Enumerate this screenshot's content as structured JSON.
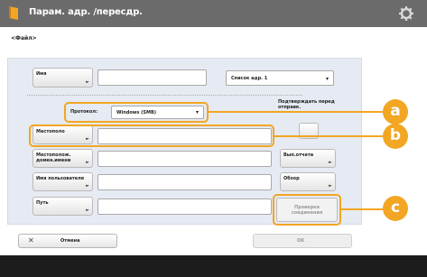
{
  "window": {
    "title": "Парам. адр. /пересдр."
  },
  "subtitle": "<Файл>",
  "form": {
    "name_button": "Имя",
    "dest_dropdown": "Список адр. 1",
    "protocol_label": "Протокол:",
    "protocol_value": "Windows (SMB)",
    "confirm_label": "Подтверждать перед отправк.",
    "location_button": "Местополо",
    "location_arrow": "►",
    "hostname_button": "Местополож. домен.имени",
    "username_button": "Имя пользователя",
    "path_button": "Путь",
    "route_button": "Вып.отчета",
    "browse_button": "Обзор",
    "check_connection_button": "Проверка соединения"
  },
  "callouts": {
    "a": "a",
    "b": "b",
    "c": "c"
  },
  "footer": {
    "cancel_label": "Отмена",
    "ok_label": "OK"
  },
  "colors": {
    "accent": "#f2a623",
    "titlebar": "#6b6b6b"
  }
}
